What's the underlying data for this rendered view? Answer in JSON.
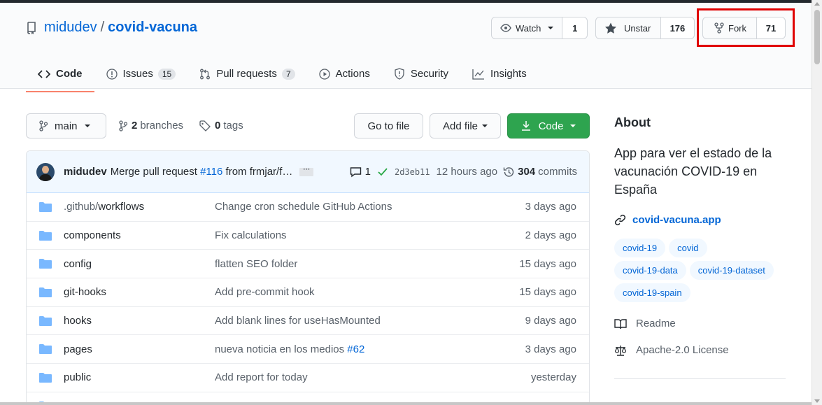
{
  "repo": {
    "owner": "midudev",
    "separator": "/",
    "name": "covid-vacuna"
  },
  "actions": {
    "watch": {
      "label": "Watch",
      "count": "1"
    },
    "star": {
      "label": "Unstar",
      "count": "176"
    },
    "fork": {
      "label": "Fork",
      "count": "71"
    }
  },
  "tabs": [
    {
      "label": "Code",
      "icon": "code-icon"
    },
    {
      "label": "Issues",
      "count": "15",
      "icon": "issue-icon"
    },
    {
      "label": "Pull requests",
      "count": "7",
      "icon": "pull-request-icon"
    },
    {
      "label": "Actions",
      "icon": "play-icon"
    },
    {
      "label": "Security",
      "icon": "shield-icon"
    },
    {
      "label": "Insights",
      "icon": "graph-icon"
    }
  ],
  "toolbar": {
    "branch": "main",
    "branches_count": "2",
    "branches_label": "branches",
    "tags_count": "0",
    "tags_label": "tags",
    "go_to_file": "Go to file",
    "add_file": "Add file",
    "code": "Code"
  },
  "commit": {
    "author": "midudev",
    "message_prefix": "Merge pull request",
    "pr_link": "#116",
    "message_suffix": "from frmjar/f…",
    "ellipsis": "···",
    "comments": "1",
    "sha": "2d3eb11",
    "time": "12 hours ago",
    "commits_count": "304",
    "commits_label": "commits"
  },
  "files": [
    {
      "name_dim": ".github/",
      "name": "workflows",
      "message": "Change cron schedule GitHub Actions",
      "age": "3 days ago"
    },
    {
      "name": "components",
      "message": "Fix calculations",
      "age": "2 days ago"
    },
    {
      "name": "config",
      "message": "flatten SEO folder",
      "age": "15 days ago"
    },
    {
      "name": "git-hooks",
      "message": "Add pre-commit hook",
      "age": "15 days ago"
    },
    {
      "name": "hooks",
      "message": "Add blank lines for useHasMounted",
      "age": "9 days ago"
    },
    {
      "name": "pages",
      "message": "nueva noticia en los medios",
      "message_link": "#62",
      "age": "3 days ago"
    },
    {
      "name": "public",
      "message": "Add report for today",
      "age": "yesterday"
    }
  ],
  "about": {
    "title": "About",
    "description": "App para ver el estado de la vacunación COVID-19 en España",
    "website": "covid-vacuna.app",
    "topics": [
      "covid-19",
      "covid",
      "covid-19-data",
      "covid-19-dataset",
      "covid-19-spain"
    ],
    "readme": "Readme",
    "license": "Apache-2.0 License"
  },
  "colors": {
    "link": "#0366d6",
    "green_button": "#2ea44f",
    "tab_underline": "#f9826c",
    "highlight": "#e00000"
  }
}
